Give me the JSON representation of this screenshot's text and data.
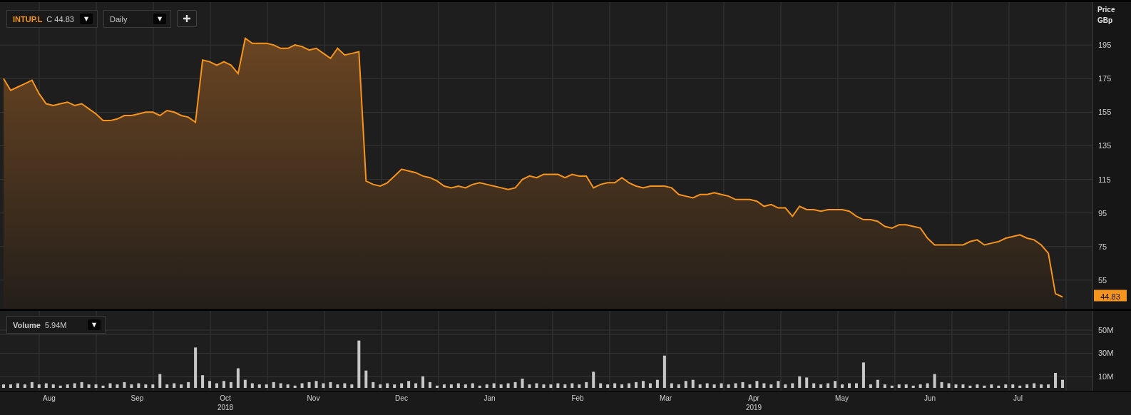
{
  "symbol_selector": {
    "label": "C",
    "value": "44.83",
    "caret": "▼"
  },
  "interval_selector": {
    "value": "Daily",
    "caret": "▼"
  },
  "price_axis": {
    "title": "Price",
    "unit": "GBp",
    "last_price": "44.83"
  },
  "price_chart": {
    "chart_data": {
      "type": "area",
      "grid": true,
      "ylim": [
        38,
        220.5
      ],
      "yticks": [
        55,
        75,
        95,
        115,
        135,
        155,
        175,
        195
      ],
      "series": [
        {
          "name": "INTUP.L",
          "color": "#f7941d",
          "values": [
            175,
            168,
            170,
            172,
            174,
            166,
            160,
            159,
            160,
            161,
            159,
            160,
            157,
            154,
            150,
            150,
            151,
            153,
            153,
            154,
            155,
            155,
            153,
            156,
            155,
            153,
            152,
            149,
            186,
            185,
            183,
            185,
            183,
            178,
            199,
            196,
            196,
            196,
            195,
            193,
            193,
            195,
            194,
            192,
            193,
            190,
            187,
            193,
            189,
            190,
            191,
            114,
            112,
            111,
            113,
            117,
            121,
            120,
            119,
            117,
            116,
            114,
            111,
            110,
            111,
            110,
            112,
            113,
            112,
            111,
            110,
            109,
            110,
            115,
            117,
            116,
            118,
            118,
            118,
            116,
            118,
            117,
            117,
            110,
            112,
            113,
            113,
            116,
            113,
            111,
            110,
            111,
            111,
            111,
            110,
            106,
            105,
            104,
            106,
            106,
            107,
            106,
            105,
            103,
            103,
            103,
            102,
            99,
            100,
            98,
            98,
            93,
            99,
            97,
            97,
            96,
            97,
            97,
            97,
            96,
            93,
            91,
            91,
            90,
            87,
            86,
            88,
            88,
            87,
            86,
            80,
            76,
            76,
            76,
            76,
            76,
            78,
            79,
            76,
            77,
            78,
            80,
            81,
            82,
            80,
            79,
            76,
            71,
            47,
            45
          ]
        }
      ]
    }
  },
  "volume_selector": {
    "value": "5.94M",
    "caret": "▼"
  },
  "x_axis": {
    "months": [
      {
        "label": "Aug"
      },
      {
        "label": "Sep"
      },
      {
        "label": "Oct",
        "year": "2018"
      },
      {
        "label": "Nov"
      },
      {
        "label": "Dec"
      },
      {
        "label": "Jan"
      },
      {
        "label": "Feb"
      },
      {
        "label": "Mar"
      },
      {
        "label": "Apr",
        "year": "2019"
      },
      {
        "label": "May"
      },
      {
        "label": "Jun"
      },
      {
        "label": "Jul"
      }
    ]
  },
  "volume_chart": {
    "chart_data": {
      "type": "bar",
      "grid": true,
      "ylim": [
        0,
        66.7
      ],
      "yticks": [
        {
          "value": 10,
          "label": "10M"
        },
        {
          "value": 30,
          "label": "30M"
        },
        {
          "value": 50,
          "label": "50M"
        }
      ],
      "series": [
        {
          "name": "Volume",
          "color": "#c8c8c8",
          "values": [
            3,
            3,
            4,
            3,
            5,
            3,
            4,
            3,
            2,
            3,
            4,
            5,
            3,
            3,
            2,
            4,
            3,
            5,
            3,
            4,
            3,
            3,
            12,
            3,
            4,
            3,
            5,
            35,
            11,
            6,
            4,
            6,
            5,
            17,
            7,
            4,
            3,
            3,
            5,
            4,
            3,
            2,
            4,
            5,
            6,
            4,
            5,
            3,
            4,
            3,
            41,
            15,
            5,
            3,
            4,
            3,
            4,
            6,
            4,
            10,
            5,
            2,
            3,
            3,
            4,
            3,
            4,
            2,
            3,
            4,
            3,
            4,
            5,
            8,
            3,
            4,
            3,
            3,
            4,
            3,
            4,
            3,
            5,
            14,
            4,
            3,
            4,
            3,
            4,
            5,
            6,
            4,
            7,
            28,
            4,
            3,
            6,
            7,
            3,
            4,
            3,
            4,
            3,
            4,
            5,
            3,
            6,
            4,
            3,
            6,
            3,
            4,
            10,
            9,
            4,
            3,
            4,
            6,
            3,
            4,
            4,
            22,
            3,
            7,
            3,
            2,
            3,
            3,
            2,
            3,
            4,
            12,
            5,
            4,
            3,
            3,
            2,
            3,
            2,
            3,
            2,
            3,
            3,
            2,
            3,
            4,
            3,
            3,
            13,
            7
          ]
        }
      ]
    }
  }
}
